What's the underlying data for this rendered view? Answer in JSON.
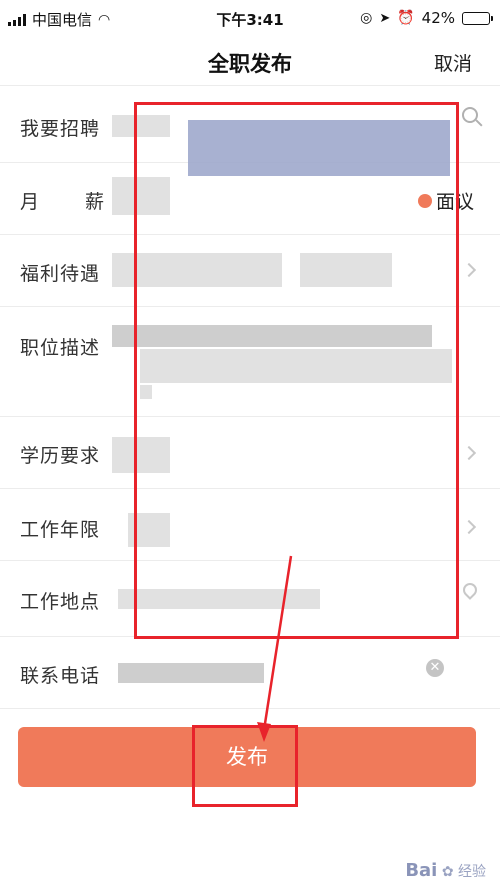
{
  "status_bar": {
    "carrier": "中国电信",
    "time": "下午3:41",
    "battery_percent": "42%",
    "battery_level": 0.42
  },
  "nav": {
    "title": "全职发布",
    "cancel": "取消"
  },
  "form": {
    "job": {
      "label": "我要招聘"
    },
    "salary": {
      "label": "月薪",
      "negotiable": "面议"
    },
    "benefits": {
      "label": "福利待遇"
    },
    "description": {
      "label": "职位描述"
    },
    "education": {
      "label": "学历要求"
    },
    "experience": {
      "label": "工作年限"
    },
    "location": {
      "label": "工作地点"
    },
    "phone": {
      "label": "联系电话"
    }
  },
  "publish_button": "发布",
  "colors": {
    "accent": "#f07a5a",
    "annotation_red": "#e8232b"
  },
  "watermark": {
    "brand": "Bai",
    "text": "经验"
  }
}
